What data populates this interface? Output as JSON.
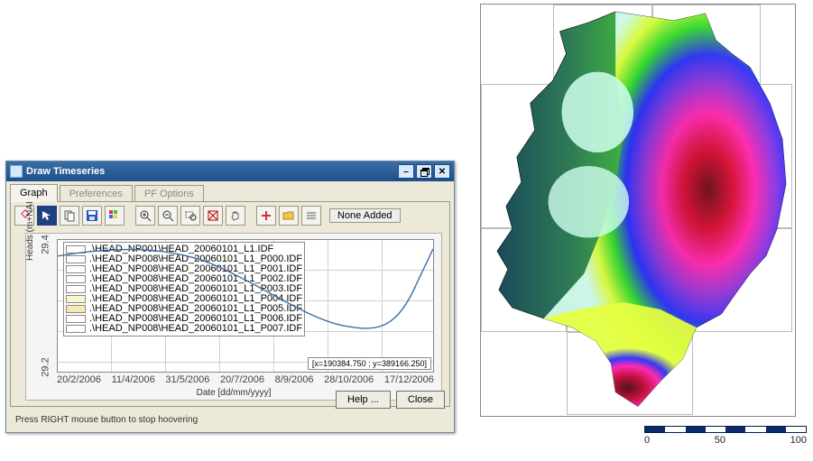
{
  "dialog": {
    "title": "Draw Timeseries",
    "tabs": [
      "Graph",
      "Preferences",
      "PF Options"
    ],
    "active_tab": 0,
    "toolbar_status": "None Added",
    "help_label": "Help ...",
    "close_label": "Close",
    "hint": "Press RIGHT mouse button to stop hoovering"
  },
  "chart_data": {
    "type": "line",
    "xlabel": "Date [dd/mm/yyyy]",
    "ylabel": "Heads (m+NAP)",
    "x_ticks": [
      "20/2/2006",
      "11/4/2006",
      "31/5/2006",
      "20/7/2006",
      "8/9/2006",
      "28/10/2006",
      "17/12/2006"
    ],
    "y_ticks": [
      "29.2",
      "29.4"
    ],
    "ylim": [
      29.1,
      29.55
    ],
    "coord_readout": "[x=190384.750 ; y=389166.250]",
    "series": [
      {
        "name": ".\\HEAD_NP001\\HEAD_20060101_L1.IDF",
        "swatch": "#ffffff"
      },
      {
        "name": ".\\HEAD_NP008\\HEAD_20060101_L1_P000.IDF",
        "swatch": "#ffffff"
      },
      {
        "name": ".\\HEAD_NP008\\HEAD_20060101_L1_P001.IDF",
        "swatch": "#ffffff"
      },
      {
        "name": ".\\HEAD_NP008\\HEAD_20060101_L1_P002.IDF",
        "swatch": "#ffffff"
      },
      {
        "name": ".\\HEAD_NP008\\HEAD_20060101_L1_P003.IDF",
        "swatch": "#ffffff"
      },
      {
        "name": ".\\HEAD_NP008\\HEAD_20060101_L1_P004.IDF",
        "swatch": "#f9f7d0"
      },
      {
        "name": ".\\HEAD_NP008\\HEAD_20060101_L1_P005.IDF",
        "swatch": "#f8e9b0"
      },
      {
        "name": ".\\HEAD_NP008\\HEAD_20060101_L1_P006.IDF",
        "swatch": "#ffffff"
      },
      {
        "name": ".\\HEAD_NP008\\HEAD_20060101_L1_P007.IDF",
        "swatch": "#ffffff"
      }
    ],
    "line_path": "M0,18 C60,8 125,5 180,30 C235,55 280,88 320,96 C360,104 380,98 402,48 L420,10"
  },
  "map": {
    "scalebar": {
      "ticks": [
        "0",
        "50",
        "100"
      ]
    }
  }
}
